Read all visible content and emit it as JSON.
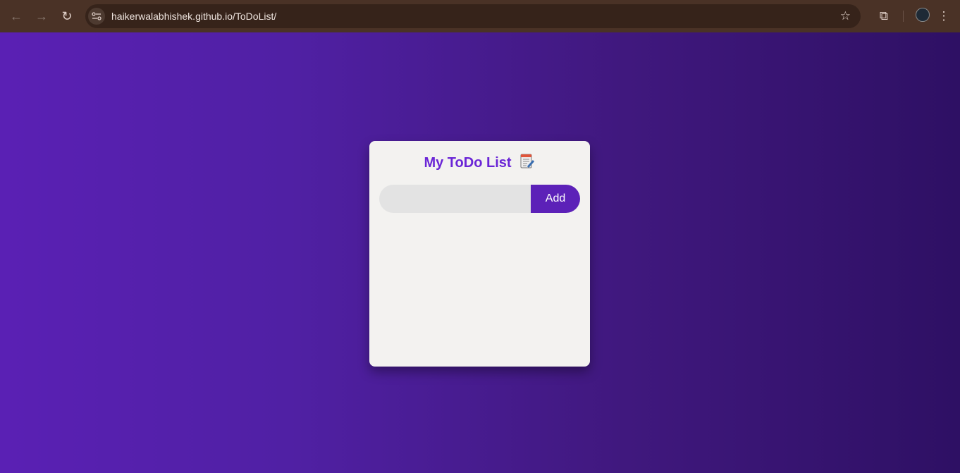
{
  "browser": {
    "url": "haikerwalabhishek.github.io/ToDoList/"
  },
  "app": {
    "title": "My ToDo List",
    "input_placeholder": "",
    "add_label": "Add"
  },
  "colors": {
    "accent": "#5c21b8",
    "title": "#6a25d6"
  }
}
